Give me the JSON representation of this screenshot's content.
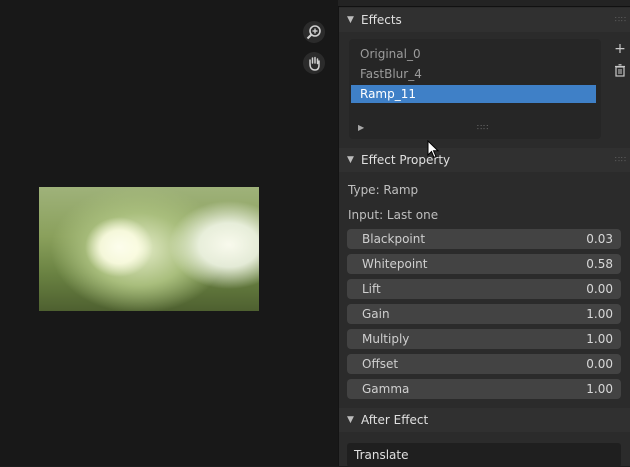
{
  "effects_panel": {
    "title": "Effects",
    "items": [
      {
        "label": "Original_0",
        "selected": false
      },
      {
        "label": "FastBlur_4",
        "selected": false
      },
      {
        "label": "Ramp_11",
        "selected": true
      }
    ],
    "add_icon": "plus-icon",
    "remove_icon": "trash-icon"
  },
  "effect_property": {
    "title": "Effect Property",
    "type_text": "Type: Ramp",
    "input_text": "Input: Last one",
    "fields": [
      {
        "label": "Blackpoint",
        "value": "0.03"
      },
      {
        "label": "Whitepoint",
        "value": "0.58"
      },
      {
        "label": "Lift",
        "value": "0.00"
      },
      {
        "label": "Gain",
        "value": "1.00"
      },
      {
        "label": "Multiply",
        "value": "1.00"
      },
      {
        "label": "Offset",
        "value": "0.00"
      },
      {
        "label": "Gamma",
        "value": "1.00"
      }
    ]
  },
  "after_effect": {
    "title": "After Effect",
    "button_label": "Translate"
  },
  "colors": {
    "selection": "#3f80c7",
    "panel_bg": "#2b2b2b",
    "field_bg": "#434343"
  }
}
